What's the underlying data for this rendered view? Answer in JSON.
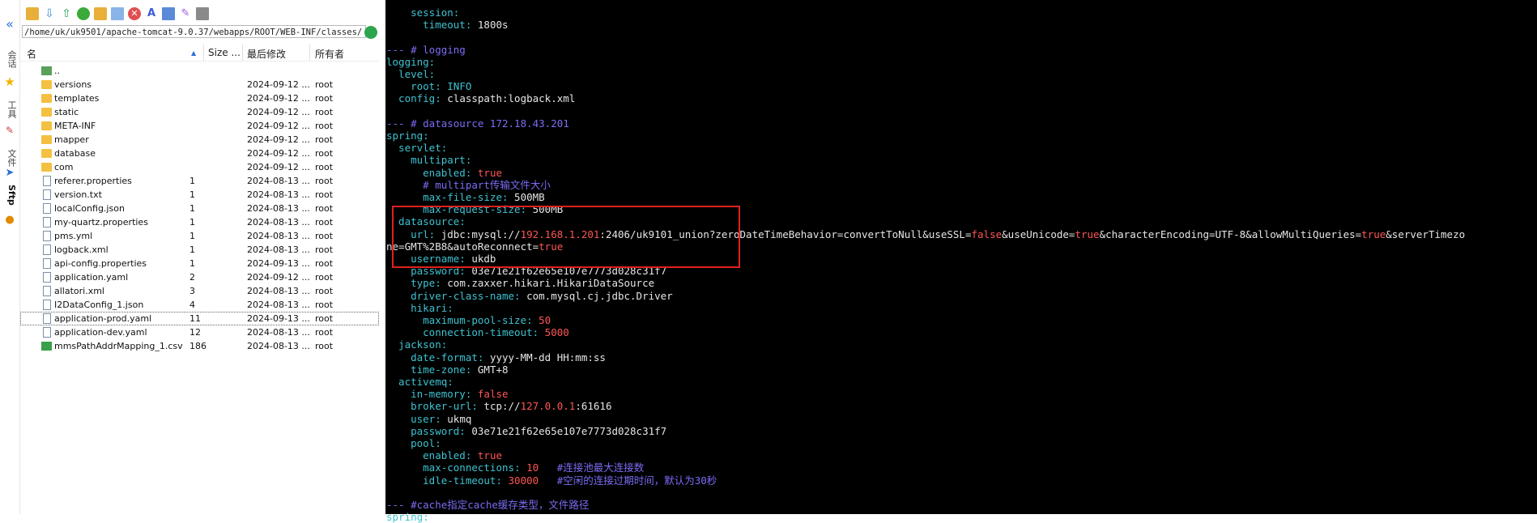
{
  "sidebar": {
    "labels": [
      "会话",
      "工具",
      "文件"
    ],
    "sftp_label": "Sftp"
  },
  "file_manager": {
    "path": "/home/uk/uk9501/apache-tomcat-9.0.37/webapps/ROOT/WEB-INF/classes/",
    "columns": {
      "name": "名",
      "size": "Size ...",
      "modified": "最后修改",
      "owner": "所有者"
    },
    "sort_indicator": "▲",
    "rows": [
      {
        "name": "..",
        "size": "",
        "modified": "",
        "owner": "",
        "type": "updir"
      },
      {
        "name": "versions",
        "size": "",
        "modified": "2024-09-12 ...",
        "owner": "root",
        "type": "folder"
      },
      {
        "name": "templates",
        "size": "",
        "modified": "2024-09-12 ...",
        "owner": "root",
        "type": "folder"
      },
      {
        "name": "static",
        "size": "",
        "modified": "2024-09-12 ...",
        "owner": "root",
        "type": "folder"
      },
      {
        "name": "META-INF",
        "size": "",
        "modified": "2024-09-12 ...",
        "owner": "root",
        "type": "folder"
      },
      {
        "name": "mapper",
        "size": "",
        "modified": "2024-09-12 ...",
        "owner": "root",
        "type": "folder"
      },
      {
        "name": "database",
        "size": "",
        "modified": "2024-09-12 ...",
        "owner": "root",
        "type": "folder"
      },
      {
        "name": "com",
        "size": "",
        "modified": "2024-09-12 ...",
        "owner": "root",
        "type": "folder"
      },
      {
        "name": "referer.properties",
        "size": "1",
        "modified": "2024-08-13 ...",
        "owner": "root",
        "type": "file"
      },
      {
        "name": "version.txt",
        "size": "1",
        "modified": "2024-08-13 ...",
        "owner": "root",
        "type": "file"
      },
      {
        "name": "localConfig.json",
        "size": "1",
        "modified": "2024-08-13 ...",
        "owner": "root",
        "type": "file"
      },
      {
        "name": "my-quartz.properties",
        "size": "1",
        "modified": "2024-08-13 ...",
        "owner": "root",
        "type": "file"
      },
      {
        "name": "pms.yml",
        "size": "1",
        "modified": "2024-08-13 ...",
        "owner": "root",
        "type": "file"
      },
      {
        "name": "logback.xml",
        "size": "1",
        "modified": "2024-08-13 ...",
        "owner": "root",
        "type": "file"
      },
      {
        "name": "api-config.properties",
        "size": "1",
        "modified": "2024-09-13 ...",
        "owner": "root",
        "type": "file"
      },
      {
        "name": "application.yaml",
        "size": "2",
        "modified": "2024-09-12 ...",
        "owner": "root",
        "type": "file"
      },
      {
        "name": "allatori.xml",
        "size": "3",
        "modified": "2024-08-13 ...",
        "owner": "root",
        "type": "file"
      },
      {
        "name": "I2DataConfig_1.json",
        "size": "4",
        "modified": "2024-08-13 ...",
        "owner": "root",
        "type": "file"
      },
      {
        "name": "application-prod.yaml",
        "size": "11",
        "modified": "2024-09-13 ...",
        "owner": "root",
        "type": "file",
        "selected": true
      },
      {
        "name": "application-dev.yaml",
        "size": "12",
        "modified": "2024-08-13 ...",
        "owner": "root",
        "type": "file"
      },
      {
        "name": "mmsPathAddrMapping_1.csv",
        "size": "186",
        "modified": "2024-08-13 ...",
        "owner": "root",
        "type": "csv"
      }
    ]
  },
  "terminal": {
    "lines": [
      [
        [
          "k",
          "    session:"
        ]
      ],
      [
        [
          "k",
          "      timeout: "
        ],
        [
          "w",
          "1800s"
        ]
      ],
      [
        [
          "w",
          ""
        ]
      ],
      [
        [
          "c",
          "--- # logging"
        ]
      ],
      [
        [
          "k",
          "logging:"
        ]
      ],
      [
        [
          "k",
          "  level:"
        ]
      ],
      [
        [
          "k",
          "    root: "
        ],
        [
          "k",
          "INFO"
        ]
      ],
      [
        [
          "k",
          "  config: "
        ],
        [
          "w",
          "classpath:logback.xml"
        ]
      ],
      [
        [
          "w",
          ""
        ]
      ],
      [
        [
          "c",
          "--- # datasource 172.18.43.201"
        ]
      ],
      [
        [
          "k",
          "spring:"
        ]
      ],
      [
        [
          "k",
          "  servlet:"
        ]
      ],
      [
        [
          "k",
          "    multipart:"
        ]
      ],
      [
        [
          "k",
          "      enabled: "
        ],
        [
          "r",
          "true"
        ]
      ],
      [
        [
          "c",
          "      # multipart传输文件大小"
        ]
      ],
      [
        [
          "k",
          "      max-file-size: "
        ],
        [
          "w",
          "500MB"
        ]
      ],
      [
        [
          "k",
          "      max-request-size: "
        ],
        [
          "w",
          "500MB"
        ]
      ],
      [
        [
          "k",
          "  datasource:"
        ]
      ],
      [
        [
          "k",
          "    url: "
        ],
        [
          "w",
          "jdbc:mysql://"
        ],
        [
          "r",
          "192.168.1.201"
        ],
        [
          "w",
          ":2406/uk9101_union?zeroDateTimeBehavior=convertToNull&useSSL="
        ],
        [
          "r",
          "false"
        ],
        [
          "w",
          "&useUnicode="
        ],
        [
          "r",
          "true"
        ],
        [
          "w",
          "&characterEncoding=UTF-8&allowMultiQueries="
        ],
        [
          "r",
          "true"
        ],
        [
          "w",
          "&serverTimezo"
        ]
      ],
      [
        [
          "w",
          "ne=GMT%2B8&autoReconnect="
        ],
        [
          "r",
          "true"
        ]
      ],
      [
        [
          "k",
          "    username: "
        ],
        [
          "w",
          "ukdb"
        ]
      ],
      [
        [
          "k",
          "    password: "
        ],
        [
          "w",
          "03e71e21f62e65e107e7773d028c31f7"
        ]
      ],
      [
        [
          "k",
          "    type: "
        ],
        [
          "w",
          "com.zaxxer.hikari.HikariDataSource"
        ]
      ],
      [
        [
          "k",
          "    driver-class-name: "
        ],
        [
          "w",
          "com.mysql.cj.jdbc.Driver"
        ]
      ],
      [
        [
          "k",
          "    hikari:"
        ]
      ],
      [
        [
          "k",
          "      maximum-pool-size: "
        ],
        [
          "r",
          "50"
        ]
      ],
      [
        [
          "k",
          "      connection-timeout: "
        ],
        [
          "r",
          "5000"
        ]
      ],
      [
        [
          "k",
          "  jackson:"
        ]
      ],
      [
        [
          "k",
          "    date-format: "
        ],
        [
          "w",
          "yyyy-MM-dd HH:mm:ss"
        ]
      ],
      [
        [
          "k",
          "    time-zone: "
        ],
        [
          "w",
          "GMT+8"
        ]
      ],
      [
        [
          "k",
          "  activemq:"
        ]
      ],
      [
        [
          "k",
          "    in-memory: "
        ],
        [
          "r",
          "false"
        ]
      ],
      [
        [
          "k",
          "    broker-url: "
        ],
        [
          "w",
          "tcp://"
        ],
        [
          "r",
          "127.0.0.1"
        ],
        [
          "w",
          ":61616"
        ]
      ],
      [
        [
          "k",
          "    user: "
        ],
        [
          "w",
          "ukmq"
        ]
      ],
      [
        [
          "k",
          "    password: "
        ],
        [
          "w",
          "03e71e21f62e65e107e7773d028c31f7"
        ]
      ],
      [
        [
          "k",
          "    pool:"
        ]
      ],
      [
        [
          "k",
          "      enabled: "
        ],
        [
          "r",
          "true"
        ]
      ],
      [
        [
          "k",
          "      max-connections: "
        ],
        [
          "r",
          "10"
        ],
        [
          "c",
          "   #连接池最大连接数"
        ]
      ],
      [
        [
          "k",
          "      idle-timeout: "
        ],
        [
          "r",
          "30000"
        ],
        [
          "c",
          "   #空闲的连接过期时间，默认为30秒"
        ]
      ],
      [
        [
          "w",
          ""
        ]
      ],
      [
        [
          "c",
          "--- #cache指定cache缓存类型，文件路径"
        ]
      ],
      [
        [
          "k",
          "spring:"
        ]
      ]
    ]
  },
  "colors": {
    "terminal_bg": "#000000",
    "key": "#3ec2d0",
    "comment": "#7b6cf5",
    "value_red": "#ff5555",
    "highlight_box": "#e02020"
  }
}
